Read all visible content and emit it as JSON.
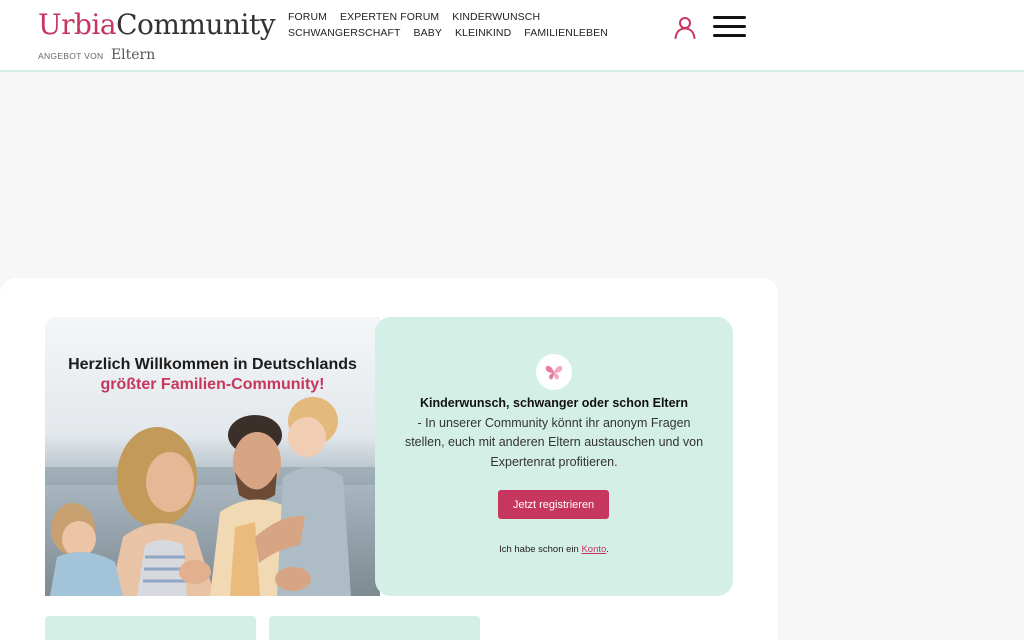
{
  "brand": {
    "logo_primary": "Urbia",
    "logo_secondary": "Community",
    "offered_by": "ANGEBOT VON",
    "offered_by_brand": "Eltern",
    "accent_color": "#c7365f",
    "mint_color": "#d4efe6"
  },
  "nav": {
    "items": [
      "FORUM",
      "EXPERTEN FORUM",
      "KINDERWUNSCH",
      "SCHWANGERSCHAFT",
      "BABY",
      "KLEINKIND",
      "FAMILIENLEBEN"
    ],
    "icons": {
      "account": "user-icon",
      "menu": "hamburger-menu-icon"
    }
  },
  "hero": {
    "welcome_line": "Herzlich Willkommen in Deutschlands",
    "welcome_highlight": "größter Familien-Community!",
    "badge_icon": "butterfly-icon",
    "intro_bold": "Kinderwunsch, schwanger oder schon Eltern",
    "intro_text": "- In unserer Community könnt ihr anonym Fragen stellen, euch mit anderen Eltern austauschen und von Expertenrat profitieren.",
    "register_label": "Jetzt registrieren",
    "login_prefix": "Ich habe schon ein",
    "login_link": "Konto",
    "login_suffix": "."
  }
}
